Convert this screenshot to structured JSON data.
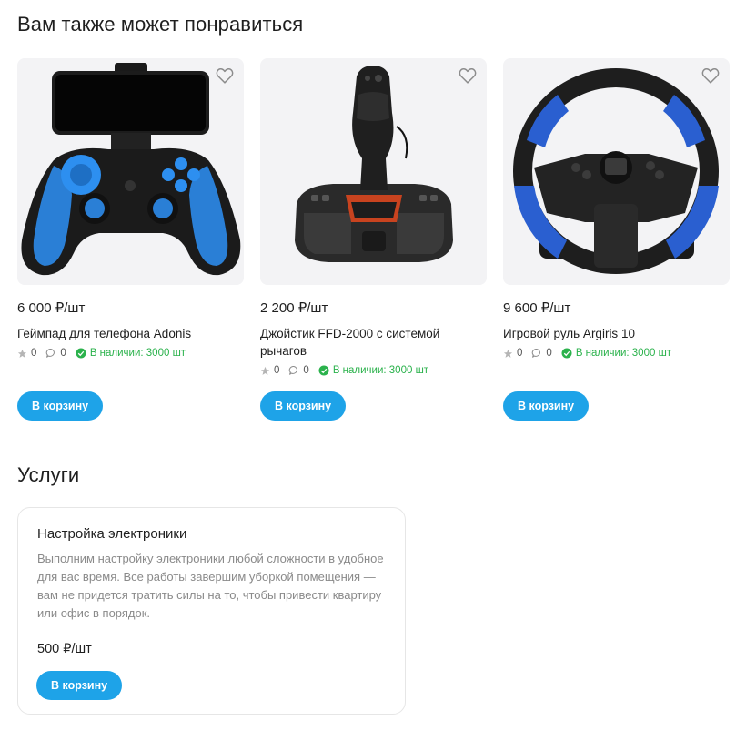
{
  "recommend": {
    "title": "Вам также может понравиться",
    "products": [
      {
        "name": "Геймпад для телефона Adonis",
        "price": "6 000 ₽/шт",
        "rating": "0",
        "comments": "0",
        "stock": "В наличии: 3000 шт",
        "button": "В корзину",
        "icon": "gamepad-image"
      },
      {
        "name": "Джойстик FFD-2000 с системой рычагов",
        "price": "2 200 ₽/шт",
        "rating": "0",
        "comments": "0",
        "stock": "В наличии: 3000 шт",
        "button": "В корзину",
        "icon": "joystick-image"
      },
      {
        "name": "Игровой руль Argiris 10",
        "price": "9 600 ₽/шт",
        "rating": "0",
        "comments": "0",
        "stock": "В наличии: 3000 шт",
        "button": "В корзину",
        "icon": "steering-wheel-image"
      }
    ]
  },
  "services": {
    "title": "Услуги",
    "items": [
      {
        "title": "Настройка электроники",
        "description": "Выполним настройку электроники любой сложности в удобное для вас время. Все работы завершим уборкой помещения — вам не придется тратить силы на то, чтобы привести квартиру или офис в порядок.",
        "price": "500 ₽/шт",
        "button": "В корзину"
      }
    ]
  },
  "colors": {
    "accent": "#1ea3e8",
    "stock_green": "#2bb24c",
    "card_bg": "#f3f3f5"
  }
}
